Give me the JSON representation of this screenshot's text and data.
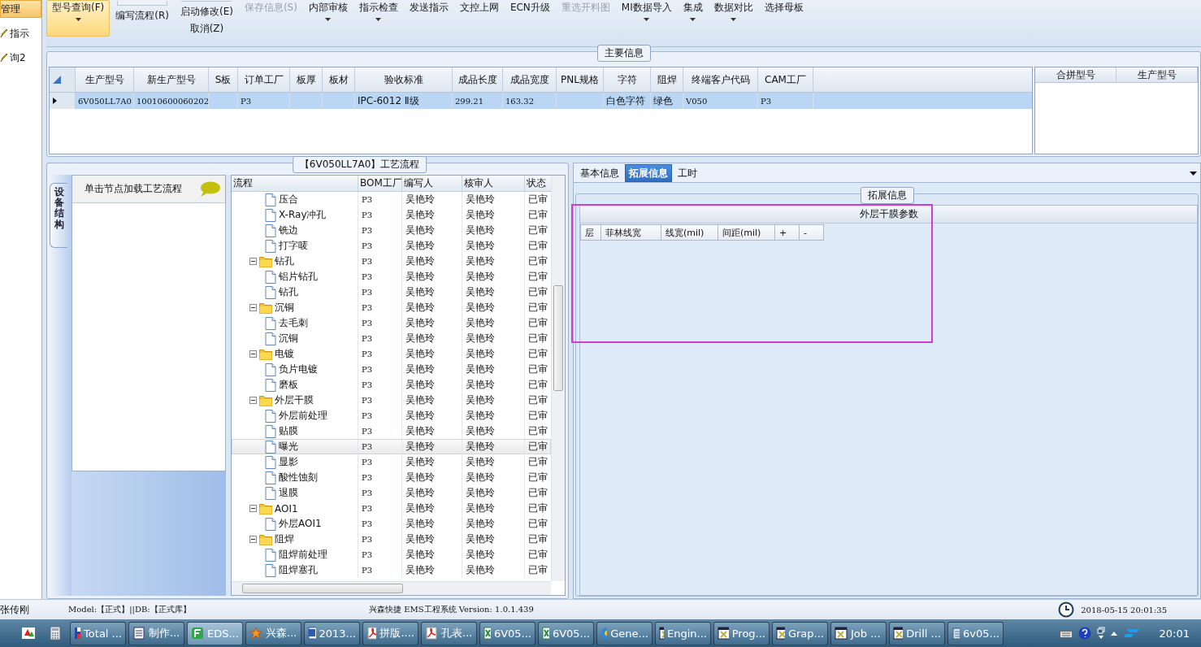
{
  "sidebar": {
    "items": [
      {
        "label": "管理",
        "selected": true,
        "kind": "plain"
      },
      {
        "label": "指示",
        "selected": false,
        "kind": "pencil"
      },
      {
        "label": "询2",
        "selected": false,
        "kind": "pencil"
      }
    ]
  },
  "toolbar": [
    {
      "label": "型号查询(F)",
      "kind": "small",
      "selected": true,
      "disabled": false,
      "menu": true
    },
    {
      "label": "编写流程(R)",
      "kind": "large",
      "selected": false,
      "disabled": false,
      "menu": false
    },
    {
      "label": "启动修改(E)",
      "sublabel": "取消(Z)",
      "kind": "large",
      "selected": false,
      "disabled": false,
      "menu": false
    },
    {
      "label": "保存信息(S)",
      "kind": "small",
      "selected": false,
      "disabled": true,
      "menu": false
    },
    {
      "label": "内部审核",
      "kind": "small",
      "selected": false,
      "disabled": false,
      "menu": true
    },
    {
      "label": "指示检查",
      "kind": "small",
      "selected": false,
      "disabled": false,
      "menu": true
    },
    {
      "label": "发送指示",
      "kind": "small",
      "selected": false,
      "disabled": false,
      "menu": false
    },
    {
      "label": "文控上网",
      "kind": "small",
      "selected": false,
      "disabled": false,
      "menu": false
    },
    {
      "label": "ECN升级",
      "kind": "small",
      "selected": false,
      "disabled": false,
      "menu": false
    },
    {
      "label": "重选开料图",
      "kind": "small",
      "selected": false,
      "disabled": true,
      "menu": false
    },
    {
      "label": "MI数据导入",
      "kind": "small",
      "selected": false,
      "disabled": false,
      "menu": true
    },
    {
      "label": "集成",
      "kind": "small",
      "selected": false,
      "disabled": false,
      "menu": true
    },
    {
      "label": "数据对比",
      "kind": "small",
      "selected": false,
      "disabled": false,
      "menu": true
    },
    {
      "label": "选择母板",
      "kind": "small",
      "selected": false,
      "disabled": false,
      "menu": false
    }
  ],
  "main_info": {
    "title": "主要信息",
    "columns": [
      "生产型号",
      "新生产型号",
      "S板",
      "订单工厂",
      "板厚",
      "板材",
      "验收标准",
      "成品长度",
      "成品宽度",
      "PNL规格",
      "字符",
      "阻焊",
      "终端客户代码",
      "CAM工厂"
    ],
    "rows": [
      {
        "selected": true,
        "cells": [
          "6V050LL7A0",
          "10010600060202",
          null,
          "P3",
          null,
          null,
          "IPC-6012 Ⅱ级",
          "299.21",
          "163.32",
          null,
          "白色字符",
          "绿色",
          "V050",
          "P3"
        ]
      }
    ],
    "merge_columns": [
      "合拼型号",
      "生产型号"
    ]
  },
  "process": {
    "title": "【6V050LL7A0】工艺流程",
    "side_tab": "设备结构",
    "hint": "单击节点加载工艺流程",
    "columns": [
      "流程",
      "BOM工厂",
      "编写人",
      "核审人",
      "状态"
    ],
    "tree": [
      {
        "children": [
          {
            "name": "压合",
            "cells": [
              "P3",
              "吴艳玲",
              "吴艳玲",
              "已审"
            ],
            "selected": false
          },
          {
            "name": "X-Ray冲孔",
            "cells": [
              "P3",
              "吴艳玲",
              "吴艳玲",
              "已审"
            ],
            "selected": false
          },
          {
            "name": "铣边",
            "cells": [
              "P3",
              "吴艳玲",
              "吴艳玲",
              "已审"
            ],
            "selected": false
          },
          {
            "name": "打字唛",
            "cells": [
              "P3",
              "吴艳玲",
              "吴艳玲",
              "已审"
            ],
            "selected": false
          }
        ]
      },
      {
        "name": "钻孔",
        "cells": [
          "P3",
          "吴艳玲",
          "吴艳玲",
          "已审"
        ],
        "selected": false,
        "expanded": true,
        "children": [
          {
            "name": "铝片钻孔",
            "cells": [
              "P3",
              "吴艳玲",
              "吴艳玲",
              "已审"
            ],
            "selected": false
          },
          {
            "name": "钻孔",
            "cells": [
              "P3",
              "吴艳玲",
              "吴艳玲",
              "已审"
            ],
            "selected": false
          }
        ]
      },
      {
        "name": "沉铜",
        "cells": [
          "P3",
          "吴艳玲",
          "吴艳玲",
          "已审"
        ],
        "selected": false,
        "expanded": true,
        "children": [
          {
            "name": "去毛刺",
            "cells": [
              "P3",
              "吴艳玲",
              "吴艳玲",
              "已审"
            ],
            "selected": false
          },
          {
            "name": "沉铜",
            "cells": [
              "P3",
              "吴艳玲",
              "吴艳玲",
              "已审"
            ],
            "selected": false
          }
        ]
      },
      {
        "name": "电镀",
        "cells": [
          "P3",
          "吴艳玲",
          "吴艳玲",
          "已审"
        ],
        "selected": false,
        "expanded": true,
        "children": [
          {
            "name": "负片电镀",
            "cells": [
              "P3",
              "吴艳玲",
              "吴艳玲",
              "已审"
            ],
            "selected": false
          },
          {
            "name": "磨板",
            "cells": [
              "P3",
              "吴艳玲",
              "吴艳玲",
              "已审"
            ],
            "selected": false
          }
        ]
      },
      {
        "name": "外层干膜",
        "cells": [
          "P3",
          "吴艳玲",
          "吴艳玲",
          "已审"
        ],
        "selected": false,
        "expanded": true,
        "children": [
          {
            "name": "外层前处理",
            "cells": [
              "P3",
              "吴艳玲",
              "吴艳玲",
              "已审"
            ],
            "selected": false
          },
          {
            "name": "贴膜",
            "cells": [
              "P3",
              "吴艳玲",
              "吴艳玲",
              "已审"
            ],
            "selected": false
          },
          {
            "name": "曝光",
            "cells": [
              "P3",
              "吴艳玲",
              "吴艳玲",
              "已审"
            ],
            "selected": true
          },
          {
            "name": "显影",
            "cells": [
              "P3",
              "吴艳玲",
              "吴艳玲",
              "已审"
            ],
            "selected": false
          },
          {
            "name": "酸性蚀刻",
            "cells": [
              "P3",
              "吴艳玲",
              "吴艳玲",
              "已审"
            ],
            "selected": false
          },
          {
            "name": "退膜",
            "cells": [
              "P3",
              "吴艳玲",
              "吴艳玲",
              "已审"
            ],
            "selected": false
          }
        ]
      },
      {
        "name": "AOI1",
        "cells": [
          "P3",
          "吴艳玲",
          "吴艳玲",
          "已审"
        ],
        "selected": false,
        "expanded": true,
        "children": [
          {
            "name": "外层AOI1",
            "cells": [
              "P3",
              "吴艳玲",
              "吴艳玲",
              "已审"
            ],
            "selected": false
          }
        ]
      },
      {
        "name": "阻焊",
        "cells": [
          "P3",
          "吴艳玲",
          "吴艳玲",
          "已审"
        ],
        "selected": false,
        "expanded": true,
        "children": [
          {
            "name": "阻焊前处理",
            "cells": [
              "P3",
              "吴艳玲",
              "吴艳玲",
              "已审"
            ],
            "selected": false
          },
          {
            "name": "阻焊塞孔",
            "cells": [
              "P3",
              "吴艳玲",
              "吴艳玲",
              "已审"
            ],
            "selected": false
          }
        ]
      }
    ]
  },
  "details": {
    "tabs": [
      {
        "label": "基本信息",
        "selected": false
      },
      {
        "label": "拓展信息",
        "selected": true
      },
      {
        "label": "工时",
        "selected": false
      }
    ],
    "group_title": "拓展信息",
    "grid_title": "外层干膜参数",
    "grid_columns": [
      "层",
      "菲林线宽",
      "线宽(mil)",
      "间距(mil)",
      "+",
      "-"
    ]
  },
  "status_bar": {
    "user": "张传刚",
    "environment": "Model:【正式】||DB:【正式库】",
    "app": "兴森快捷 EMS工程系统 Version: 1.0.1.439",
    "datetime": "2018-05-15 20:01:35"
  },
  "taskbar": {
    "items": [
      {
        "label": "Total ...",
        "kind": "disk",
        "selected": false
      },
      {
        "label": "制作...",
        "kind": "list",
        "selected": false
      },
      {
        "label": "EDS...",
        "kind": "eds",
        "selected": true
      },
      {
        "label": "兴森...",
        "kind": "star",
        "selected": false
      },
      {
        "label": "2013...",
        "kind": "word",
        "selected": false
      },
      {
        "label": "拼版....",
        "kind": "pdf",
        "selected": false
      },
      {
        "label": "孔表...",
        "kind": "pdf",
        "selected": false
      },
      {
        "label": "6V05...",
        "kind": "excel",
        "selected": false
      },
      {
        "label": "6V05...",
        "kind": "excel",
        "selected": false
      },
      {
        "label": "Gene...",
        "kind": "gene",
        "selected": false
      },
      {
        "label": "Engin...",
        "kind": "app",
        "selected": false
      },
      {
        "label": "Prog...",
        "kind": "app",
        "selected": false
      },
      {
        "label": "Grap...",
        "kind": "app",
        "selected": false
      },
      {
        "label": "Job ...",
        "kind": "app",
        "selected": false
      },
      {
        "label": "Drill ...",
        "kind": "app",
        "selected": false
      },
      {
        "label": "6v05...",
        "kind": "notepad",
        "selected": false
      }
    ],
    "clock": "20:01"
  }
}
